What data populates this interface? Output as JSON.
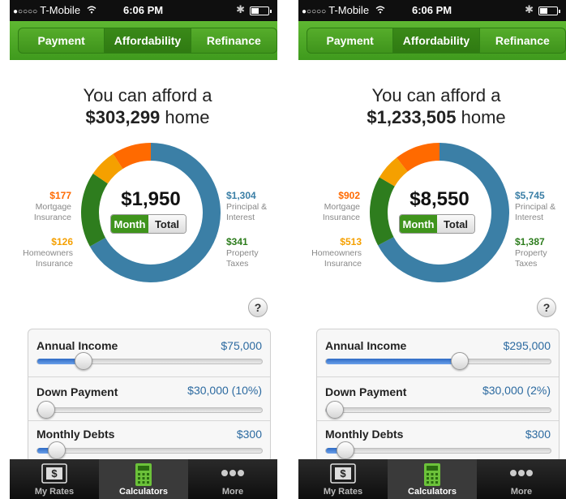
{
  "status": {
    "carrier": "T-Mobile",
    "signal_dots": "●○○○○",
    "time": "6:06 PM"
  },
  "tabs": [
    "Payment",
    "Affordability",
    "Refinance"
  ],
  "bottom_tabs": [
    {
      "label": "My Rates",
      "icon": "dollar-bill-icon"
    },
    {
      "label": "Calculators",
      "icon": "calculator-icon"
    },
    {
      "label": "More",
      "icon": "more-dots-icon"
    }
  ],
  "colors": {
    "green": "#3f941c",
    "orange_red": "#ff6a00",
    "orange": "#f5a000",
    "blue": "#3b7fa6",
    "dark_green": "#2e7d1e",
    "value_blue": "#2c6aa0"
  },
  "screens": [
    {
      "headline_line1": "You can afford a",
      "home_price": "$303,299",
      "headline_suffix": "home",
      "monthly_total": "$1,950",
      "toggle": {
        "month": "Month",
        "total": "Total"
      },
      "legend": {
        "mortgage_insurance": {
          "amount": "$177",
          "line1": "Mortgage",
          "line2": "Insurance"
        },
        "homeowners_insurance": {
          "amount": "$126",
          "line1": "Homeowners",
          "line2": "Insurance"
        },
        "principal_interest": {
          "amount": "$1,304",
          "line1": "Principal &",
          "line2": "Interest"
        },
        "property_taxes": {
          "amount": "$341",
          "line1": "Property",
          "line2": "Taxes"
        }
      },
      "breakdown": [
        {
          "name": "principal_interest",
          "value": 1304,
          "color": "#3b7fa6"
        },
        {
          "name": "property_taxes",
          "value": 341,
          "color": "#2e7d1e"
        },
        {
          "name": "homeowners_insurance",
          "value": 126,
          "color": "#f5a000"
        },
        {
          "name": "mortgage_insurance",
          "value": 177,
          "color": "#ff6a00"
        }
      ],
      "help": "?",
      "sliders": [
        {
          "label": "Annual Income",
          "value": "$75,000",
          "position": 0.18
        },
        {
          "label": "Down Payment",
          "value": "$30,000 (10%)",
          "position": 0.0
        },
        {
          "label": "Monthly Debts",
          "value": "$300",
          "position": 0.05
        }
      ]
    },
    {
      "headline_line1": "You can afford a",
      "home_price": "$1,233,505",
      "headline_suffix": "home",
      "monthly_total": "$8,550",
      "toggle": {
        "month": "Month",
        "total": "Total"
      },
      "legend": {
        "mortgage_insurance": {
          "amount": "$902",
          "line1": "Mortgage",
          "line2": "Insurance"
        },
        "homeowners_insurance": {
          "amount": "$513",
          "line1": "Homeowners",
          "line2": "Insurance"
        },
        "principal_interest": {
          "amount": "$5,745",
          "line1": "Principal &",
          "line2": "Interest"
        },
        "property_taxes": {
          "amount": "$1,387",
          "line1": "Property",
          "line2": "Taxes"
        }
      },
      "breakdown": [
        {
          "name": "principal_interest",
          "value": 5745,
          "color": "#3b7fa6"
        },
        {
          "name": "property_taxes",
          "value": 1387,
          "color": "#2e7d1e"
        },
        {
          "name": "homeowners_insurance",
          "value": 513,
          "color": "#f5a000"
        },
        {
          "name": "mortgage_insurance",
          "value": 902,
          "color": "#ff6a00"
        }
      ],
      "help": "?",
      "sliders": [
        {
          "label": "Annual Income",
          "value": "$295,000",
          "position": 0.6
        },
        {
          "label": "Down Payment",
          "value": "$30,000 (2%)",
          "position": 0.0
        },
        {
          "label": "Monthly Debts",
          "value": "$300",
          "position": 0.05
        }
      ]
    }
  ]
}
